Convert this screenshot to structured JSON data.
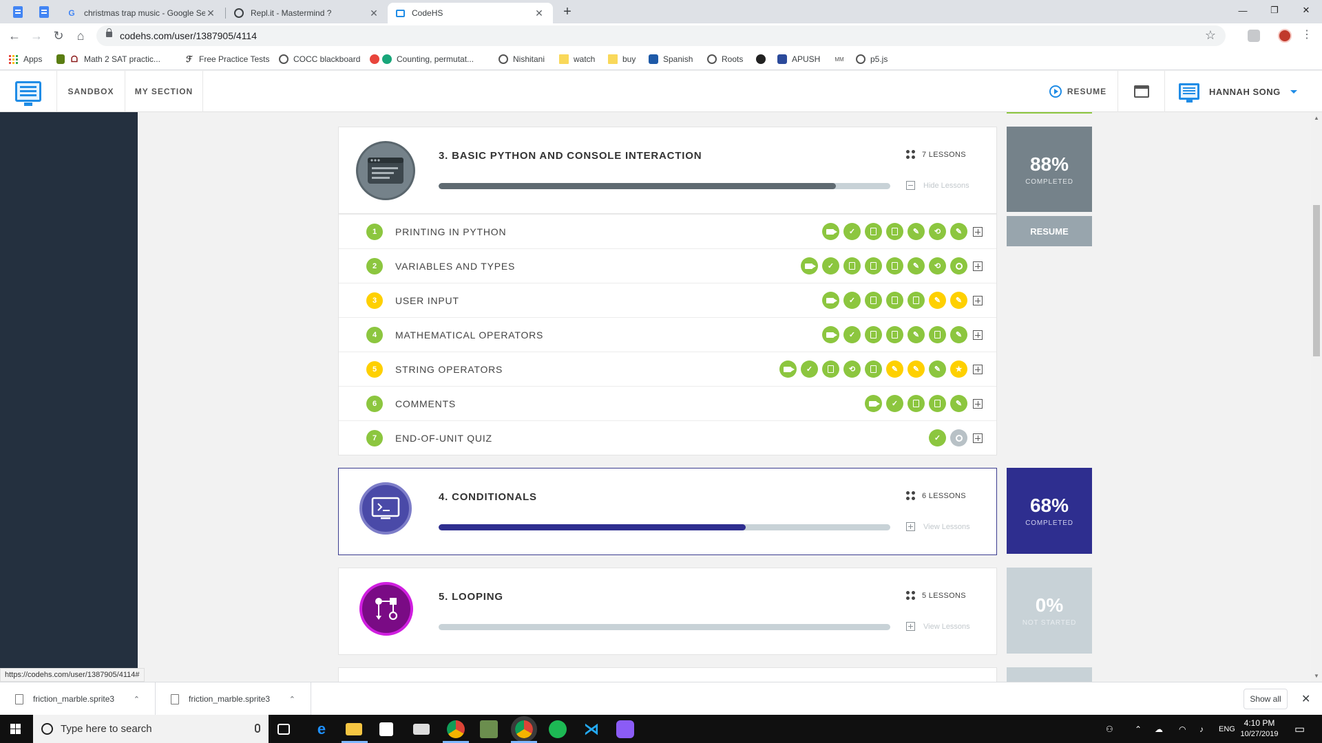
{
  "browser": {
    "tabs": [
      {
        "title": "christmas trap music - Google Se",
        "favicon": "G"
      },
      {
        "title": "Repl.it - Mastermind ?",
        "favicon": "R"
      },
      {
        "title": "CodeHS",
        "favicon": "C"
      }
    ],
    "url": "codehs.com/user/1387905/4114",
    "status_url": "https://codehs.com/user/1387905/4114#",
    "bookmarks": [
      "Apps",
      "Math 2 SAT practic...",
      "Free Practice Tests",
      "COCC blackboard",
      "Counting, permutat...",
      "Nishitani",
      "watch",
      "buy",
      "Spanish",
      "Roots",
      "APUSH",
      "p5.js"
    ]
  },
  "header": {
    "nav": [
      "SANDBOX",
      "MY SECTION"
    ],
    "resume": "RESUME",
    "user_name": "HANNAH SONG"
  },
  "colors": {
    "green": "#8cc63f",
    "yellow": "#fed000",
    "navy": "#2e2e8f",
    "gray_box": "#75828a",
    "purple": "#c10fd1"
  },
  "units": [
    {
      "title": "3. BASIC PYTHON AND CONSOLE INTERACTION",
      "lessons_count": "7 LESSONS",
      "toggle": "Hide Lessons",
      "progress": 0.88,
      "stat_pct": "88%",
      "stat_label": "COMPLETED",
      "resume": "RESUME",
      "icon": "console-window-icon"
    },
    {
      "title": "4. CONDITIONALS",
      "lessons_count": "6 LESSONS",
      "toggle": "View Lessons",
      "progress": 0.68,
      "stat_pct": "68%",
      "stat_label": "COMPLETED",
      "icon": "terminal-monitor-icon"
    },
    {
      "title": "5. LOOPING",
      "lessons_count": "5 LESSONS",
      "toggle": "View Lessons",
      "progress": 0,
      "stat_pct": "0%",
      "stat_label": "NOT STARTED",
      "icon": "flowchart-icon"
    }
  ],
  "lessons": [
    {
      "num": "1",
      "title": "PRINTING IN PYTHON",
      "status": "green",
      "activities": [
        [
          "video",
          "green"
        ],
        [
          "check",
          "green"
        ],
        [
          "doc",
          "green"
        ],
        [
          "doc",
          "green"
        ],
        [
          "pencil",
          "green"
        ],
        [
          "code",
          "green"
        ],
        [
          "pencil",
          "green"
        ]
      ]
    },
    {
      "num": "2",
      "title": "VARIABLES AND TYPES",
      "status": "green",
      "activities": [
        [
          "video",
          "green"
        ],
        [
          "check",
          "green"
        ],
        [
          "doc",
          "green"
        ],
        [
          "doc",
          "green"
        ],
        [
          "doc",
          "green"
        ],
        [
          "pencil",
          "green"
        ],
        [
          "code",
          "green"
        ],
        [
          "ring",
          "green"
        ]
      ]
    },
    {
      "num": "3",
      "title": "USER INPUT",
      "status": "yellow",
      "activities": [
        [
          "video",
          "green"
        ],
        [
          "check",
          "green"
        ],
        [
          "doc",
          "green"
        ],
        [
          "doc",
          "green"
        ],
        [
          "doc",
          "green"
        ],
        [
          "pencil",
          "yellow"
        ],
        [
          "pencil",
          "yellow"
        ]
      ]
    },
    {
      "num": "4",
      "title": "MATHEMATICAL OPERATORS",
      "status": "green",
      "activities": [
        [
          "video",
          "green"
        ],
        [
          "check",
          "green"
        ],
        [
          "doc",
          "green"
        ],
        [
          "doc",
          "green"
        ],
        [
          "pencil",
          "green"
        ],
        [
          "doc",
          "green"
        ],
        [
          "pencil",
          "green"
        ]
      ]
    },
    {
      "num": "5",
      "title": "STRING OPERATORS",
      "status": "yellow",
      "activities": [
        [
          "video",
          "green"
        ],
        [
          "check",
          "green"
        ],
        [
          "doc",
          "green"
        ],
        [
          "code",
          "green"
        ],
        [
          "doc",
          "green"
        ],
        [
          "pencil",
          "yellow"
        ],
        [
          "pencil",
          "yellow"
        ],
        [
          "pencil",
          "green"
        ],
        [
          "star",
          "yellow"
        ]
      ]
    },
    {
      "num": "6",
      "title": "COMMENTS",
      "status": "green",
      "activities": [
        [
          "video",
          "green"
        ],
        [
          "check",
          "green"
        ],
        [
          "doc",
          "green"
        ],
        [
          "doc",
          "green"
        ],
        [
          "pencil",
          "green"
        ]
      ]
    },
    {
      "num": "7",
      "title": "END-OF-UNIT QUIZ",
      "status": "green",
      "activities": [
        [
          "check",
          "green"
        ],
        [
          "ring",
          "gray"
        ]
      ]
    }
  ],
  "downloads": [
    "friction_marble.sprite3",
    "friction_marble.sprite3"
  ],
  "show_all": "Show all",
  "taskbar": {
    "search_placeholder": "Type here to search",
    "lang": "ENG",
    "time": "4:10 PM",
    "date": "10/27/2019"
  }
}
